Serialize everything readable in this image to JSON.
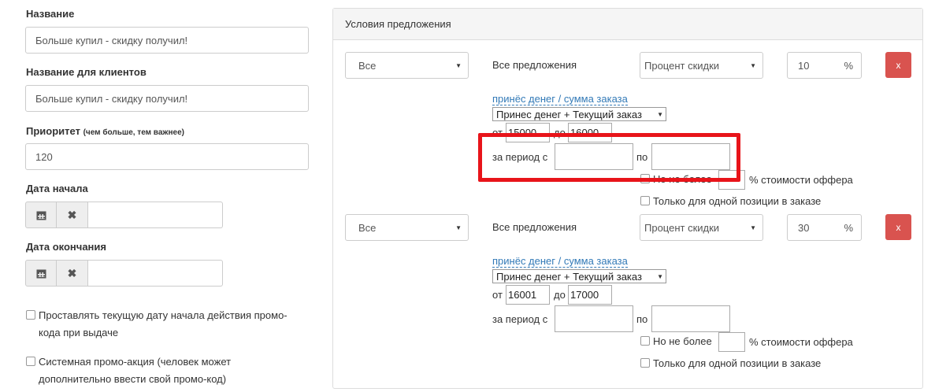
{
  "left": {
    "name_label": "Название",
    "name_value": "Больше купил - скидку получил!",
    "client_name_label": "Название для клиентов",
    "client_name_value": "Больше купил - скидку получил!",
    "priority_label": "Приоритет",
    "priority_hint": "(чем больше, тем важнее)",
    "priority_value": "120",
    "start_date_label": "Дата начала",
    "end_date_label": "Дата окончания",
    "checkbox1_label": "Проставлять текущую дату начала действия промо-кода при выдаче",
    "checkbox2_label": "Системная промо-акция (человек может дополнительно ввести свой промо-код)"
  },
  "panel": {
    "title": "Условия предложения",
    "conditions": [
      {
        "scope": "Все",
        "offers_text": "Все предложения",
        "discount_type": "Процент скидки",
        "discount_value": "10",
        "percent_sign": "%",
        "remove_label": "x",
        "criteria_link": "принёс денег / сумма заказа",
        "criteria_select": "Принес денег + Текущий заказ",
        "from_label": "от",
        "from_value": "15000",
        "to_label": "до",
        "to_value": "16000",
        "period_label": "за период с",
        "period_to_label": "по",
        "not_more_label": "Но не более",
        "cost_label": "% стоимости оффера",
        "single_position_label": "Только для одной позиции в заказе"
      },
      {
        "scope": "Все",
        "offers_text": "Все предложения",
        "discount_type": "Процент скидки",
        "discount_value": "30",
        "percent_sign": "%",
        "remove_label": "x",
        "criteria_link": "принёс денег / сумма заказа",
        "criteria_select": "Принес денег + Текущий заказ",
        "from_label": "от",
        "from_value": "16001",
        "to_label": "до",
        "to_value": "17000",
        "period_label": "за период с",
        "period_to_label": "по",
        "not_more_label": "Но не более",
        "cost_label": "% стоимости оффера",
        "single_position_label": "Только для одной позиции в заказе"
      }
    ]
  },
  "icons": {
    "calendar": "calendar-icon",
    "clear": "close-icon",
    "caret": "caret-down-icon"
  },
  "colors": {
    "highlight": "#e8141a",
    "danger": "#d9534f",
    "link": "#337ab7"
  }
}
